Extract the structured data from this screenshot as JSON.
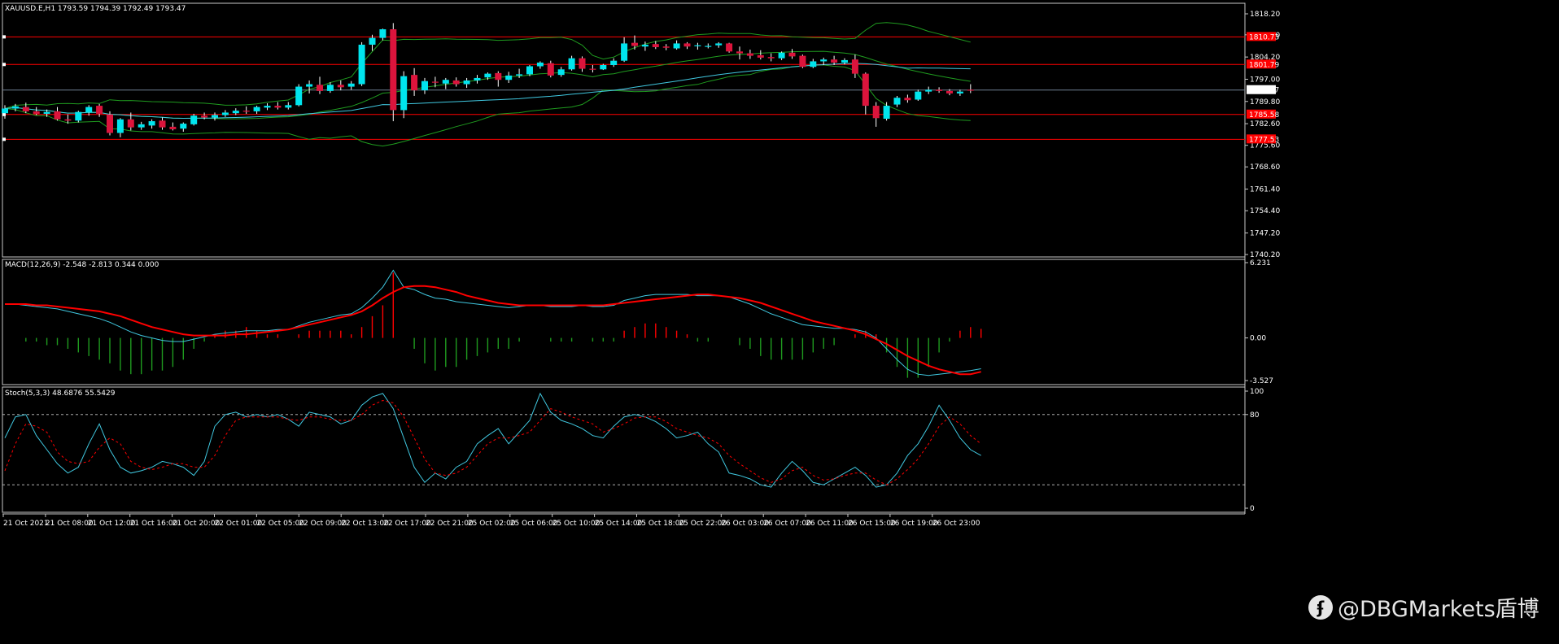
{
  "header": {
    "main": "XAUUSD.E,H1  1793.59 1794.39 1792.49 1793.47",
    "macd": "MACD(12,26,9) -2.548 -2.813 0.344 0.000",
    "stoch": "Stoch(5,3,3) 48.6876 55.5429"
  },
  "watermark": {
    "icon": "weibo-logo-icon",
    "text": "@DBGMarkets盾博"
  },
  "colors": {
    "bull": "#00e5ee",
    "bear": "#dc143c",
    "bollinger": "#1f9b1f",
    "ma": "#40c8e0",
    "level": "#ff0000",
    "signal": "#ff0000",
    "stoch_main": "#40c8e0",
    "stoch_signal": "#ff0000"
  },
  "chart_data": [
    {
      "type": "candlestick",
      "symbol": "XAUUSD.E",
      "timeframe": "H1",
      "ylim": [
        1740.2,
        1818.2
      ],
      "yticks": [
        "1818.20",
        "1811.40",
        "1804.20",
        "1797.00",
        "1789.80",
        "1782.60",
        "1775.60",
        "1768.60",
        "1761.40",
        "1754.40",
        "1747.20",
        "1740.20"
      ],
      "price_label": "1793.47",
      "levels": [
        1810.73,
        1801.79,
        1785.58,
        1777.53
      ],
      "level_labels": [
        "1810.73",
        "1801.79",
        "1785.58",
        "1777.53"
      ],
      "xticks": [
        "21 Oct 2021",
        "21 Oct 08:00",
        "21 Oct 12:00",
        "21 Oct 16:00",
        "21 Oct 20:00",
        "22 Oct 01:00",
        "22 Oct 05:00",
        "22 Oct 09:00",
        "22 Oct 13:00",
        "22 Oct 17:00",
        "22 Oct 21:00",
        "25 Oct 02:00",
        "25 Oct 06:00",
        "25 Oct 10:00",
        "25 Oct 14:00",
        "25 Oct 18:00",
        "25 Oct 22:00",
        "26 Oct 03:00",
        "26 Oct 07:00",
        "26 Oct 11:00",
        "26 Oct 15:00",
        "26 Oct 19:00",
        "26 Oct 23:00"
      ],
      "candles": [
        {
          "o": 1786.0,
          "h": 1788.6,
          "l": 1784.2,
          "c": 1787.5
        },
        {
          "o": 1787.5,
          "h": 1789.0,
          "l": 1786.6,
          "c": 1788.2
        },
        {
          "o": 1788.0,
          "h": 1789.4,
          "l": 1786.0,
          "c": 1786.6
        },
        {
          "o": 1786.6,
          "h": 1788.0,
          "l": 1785.4,
          "c": 1785.8
        },
        {
          "o": 1785.8,
          "h": 1787.2,
          "l": 1784.8,
          "c": 1786.4
        },
        {
          "o": 1786.6,
          "h": 1788.0,
          "l": 1783.6,
          "c": 1784.0
        },
        {
          "o": 1784.0,
          "h": 1785.6,
          "l": 1782.6,
          "c": 1783.6
        },
        {
          "o": 1783.6,
          "h": 1786.8,
          "l": 1783.0,
          "c": 1786.4
        },
        {
          "o": 1786.2,
          "h": 1788.6,
          "l": 1785.2,
          "c": 1788.0
        },
        {
          "o": 1788.4,
          "h": 1789.0,
          "l": 1784.8,
          "c": 1785.8
        },
        {
          "o": 1785.6,
          "h": 1786.6,
          "l": 1778.8,
          "c": 1779.6
        },
        {
          "o": 1779.6,
          "h": 1784.4,
          "l": 1778.2,
          "c": 1784.0
        },
        {
          "o": 1784.0,
          "h": 1786.2,
          "l": 1780.4,
          "c": 1781.4
        },
        {
          "o": 1781.4,
          "h": 1783.2,
          "l": 1780.6,
          "c": 1782.4
        },
        {
          "o": 1782.0,
          "h": 1784.0,
          "l": 1781.0,
          "c": 1783.4
        },
        {
          "o": 1783.6,
          "h": 1784.6,
          "l": 1780.6,
          "c": 1781.4
        },
        {
          "o": 1781.6,
          "h": 1783.0,
          "l": 1780.4,
          "c": 1780.8
        },
        {
          "o": 1781.0,
          "h": 1783.0,
          "l": 1780.0,
          "c": 1782.6
        },
        {
          "o": 1782.4,
          "h": 1785.8,
          "l": 1782.0,
          "c": 1785.2
        },
        {
          "o": 1785.2,
          "h": 1786.2,
          "l": 1784.0,
          "c": 1784.6
        },
        {
          "o": 1784.6,
          "h": 1786.2,
          "l": 1783.6,
          "c": 1785.4
        },
        {
          "o": 1785.4,
          "h": 1787.0,
          "l": 1784.8,
          "c": 1786.2
        },
        {
          "o": 1786.0,
          "h": 1787.6,
          "l": 1785.4,
          "c": 1786.8
        },
        {
          "o": 1786.8,
          "h": 1788.2,
          "l": 1785.8,
          "c": 1786.6
        },
        {
          "o": 1786.6,
          "h": 1788.4,
          "l": 1785.8,
          "c": 1788.0
        },
        {
          "o": 1787.8,
          "h": 1789.2,
          "l": 1787.0,
          "c": 1788.4
        },
        {
          "o": 1788.4,
          "h": 1789.6,
          "l": 1787.2,
          "c": 1787.8
        },
        {
          "o": 1787.8,
          "h": 1789.6,
          "l": 1787.2,
          "c": 1788.6
        },
        {
          "o": 1788.6,
          "h": 1795.4,
          "l": 1788.2,
          "c": 1794.6
        },
        {
          "o": 1794.6,
          "h": 1796.6,
          "l": 1792.4,
          "c": 1795.4
        },
        {
          "o": 1795.2,
          "h": 1797.8,
          "l": 1792.2,
          "c": 1793.2
        },
        {
          "o": 1793.2,
          "h": 1796.0,
          "l": 1792.6,
          "c": 1795.2
        },
        {
          "o": 1795.2,
          "h": 1796.6,
          "l": 1793.4,
          "c": 1794.4
        },
        {
          "o": 1794.6,
          "h": 1796.4,
          "l": 1793.6,
          "c": 1795.6
        },
        {
          "o": 1795.4,
          "h": 1809.0,
          "l": 1794.8,
          "c": 1808.2
        },
        {
          "o": 1808.2,
          "h": 1811.4,
          "l": 1806.2,
          "c": 1810.4
        },
        {
          "o": 1810.4,
          "h": 1813.4,
          "l": 1809.6,
          "c": 1813.2
        },
        {
          "o": 1813.2,
          "h": 1815.2,
          "l": 1783.4,
          "c": 1787.0
        },
        {
          "o": 1787.0,
          "h": 1799.6,
          "l": 1784.4,
          "c": 1798.0
        },
        {
          "o": 1798.4,
          "h": 1800.6,
          "l": 1791.6,
          "c": 1793.4
        },
        {
          "o": 1793.4,
          "h": 1797.4,
          "l": 1792.2,
          "c": 1796.4
        },
        {
          "o": 1796.2,
          "h": 1797.8,
          "l": 1794.4,
          "c": 1796.0
        },
        {
          "o": 1795.6,
          "h": 1797.4,
          "l": 1793.8,
          "c": 1796.8
        },
        {
          "o": 1796.6,
          "h": 1797.6,
          "l": 1794.6,
          "c": 1795.4
        },
        {
          "o": 1795.4,
          "h": 1797.4,
          "l": 1794.2,
          "c": 1796.6
        },
        {
          "o": 1796.6,
          "h": 1798.4,
          "l": 1795.6,
          "c": 1797.4
        },
        {
          "o": 1797.6,
          "h": 1799.2,
          "l": 1796.8,
          "c": 1798.8
        },
        {
          "o": 1799.0,
          "h": 1799.6,
          "l": 1794.6,
          "c": 1796.8
        },
        {
          "o": 1796.8,
          "h": 1799.4,
          "l": 1795.8,
          "c": 1798.2
        },
        {
          "o": 1798.2,
          "h": 1800.4,
          "l": 1797.4,
          "c": 1798.6
        },
        {
          "o": 1798.6,
          "h": 1801.6,
          "l": 1798.0,
          "c": 1801.2
        },
        {
          "o": 1801.2,
          "h": 1802.8,
          "l": 1800.4,
          "c": 1802.4
        },
        {
          "o": 1802.2,
          "h": 1803.0,
          "l": 1797.6,
          "c": 1798.2
        },
        {
          "o": 1798.4,
          "h": 1801.0,
          "l": 1797.8,
          "c": 1800.2
        },
        {
          "o": 1800.2,
          "h": 1804.6,
          "l": 1799.8,
          "c": 1803.8
        },
        {
          "o": 1803.8,
          "h": 1804.4,
          "l": 1799.4,
          "c": 1800.4
        },
        {
          "o": 1800.4,
          "h": 1801.6,
          "l": 1799.2,
          "c": 1800.2
        },
        {
          "o": 1800.2,
          "h": 1802.0,
          "l": 1800.0,
          "c": 1801.6
        },
        {
          "o": 1801.6,
          "h": 1803.8,
          "l": 1801.0,
          "c": 1803.0
        },
        {
          "o": 1803.0,
          "h": 1810.6,
          "l": 1802.6,
          "c": 1808.6
        },
        {
          "o": 1808.8,
          "h": 1811.2,
          "l": 1806.6,
          "c": 1807.8
        },
        {
          "o": 1807.6,
          "h": 1809.2,
          "l": 1806.2,
          "c": 1808.2
        },
        {
          "o": 1808.4,
          "h": 1809.4,
          "l": 1806.8,
          "c": 1807.4
        },
        {
          "o": 1807.6,
          "h": 1808.4,
          "l": 1806.4,
          "c": 1807.2
        },
        {
          "o": 1807.0,
          "h": 1809.6,
          "l": 1806.6,
          "c": 1808.6
        },
        {
          "o": 1808.6,
          "h": 1809.0,
          "l": 1806.8,
          "c": 1807.6
        },
        {
          "o": 1807.8,
          "h": 1808.8,
          "l": 1806.6,
          "c": 1808.0
        },
        {
          "o": 1807.8,
          "h": 1808.6,
          "l": 1807.0,
          "c": 1807.8
        },
        {
          "o": 1808.0,
          "h": 1809.0,
          "l": 1807.2,
          "c": 1808.6
        },
        {
          "o": 1808.6,
          "h": 1808.8,
          "l": 1805.6,
          "c": 1806.0
        },
        {
          "o": 1806.0,
          "h": 1807.6,
          "l": 1803.4,
          "c": 1805.4
        },
        {
          "o": 1805.4,
          "h": 1806.6,
          "l": 1803.6,
          "c": 1804.6
        },
        {
          "o": 1804.8,
          "h": 1806.4,
          "l": 1803.4,
          "c": 1804.0
        },
        {
          "o": 1804.2,
          "h": 1805.4,
          "l": 1802.8,
          "c": 1803.8
        },
        {
          "o": 1803.8,
          "h": 1806.0,
          "l": 1803.2,
          "c": 1805.6
        },
        {
          "o": 1805.6,
          "h": 1806.8,
          "l": 1803.6,
          "c": 1804.4
        },
        {
          "o": 1804.6,
          "h": 1805.0,
          "l": 1800.6,
          "c": 1801.0
        },
        {
          "o": 1801.0,
          "h": 1803.6,
          "l": 1800.6,
          "c": 1802.8
        },
        {
          "o": 1802.8,
          "h": 1804.0,
          "l": 1801.6,
          "c": 1803.4
        },
        {
          "o": 1803.4,
          "h": 1804.6,
          "l": 1801.6,
          "c": 1802.4
        },
        {
          "o": 1802.4,
          "h": 1803.8,
          "l": 1801.8,
          "c": 1803.2
        },
        {
          "o": 1803.4,
          "h": 1805.0,
          "l": 1797.4,
          "c": 1798.8
        },
        {
          "o": 1798.8,
          "h": 1799.2,
          "l": 1785.6,
          "c": 1788.4
        },
        {
          "o": 1788.4,
          "h": 1789.6,
          "l": 1781.6,
          "c": 1784.4
        },
        {
          "o": 1784.2,
          "h": 1789.6,
          "l": 1783.6,
          "c": 1788.4
        },
        {
          "o": 1788.8,
          "h": 1791.6,
          "l": 1788.0,
          "c": 1791.0
        },
        {
          "o": 1791.0,
          "h": 1792.0,
          "l": 1789.4,
          "c": 1790.2
        },
        {
          "o": 1790.4,
          "h": 1793.6,
          "l": 1790.0,
          "c": 1793.0
        },
        {
          "o": 1793.0,
          "h": 1794.6,
          "l": 1792.2,
          "c": 1793.6
        },
        {
          "o": 1793.6,
          "h": 1794.4,
          "l": 1792.6,
          "c": 1793.2
        },
        {
          "o": 1793.2,
          "h": 1793.8,
          "l": 1791.8,
          "c": 1792.4
        },
        {
          "o": 1792.4,
          "h": 1793.6,
          "l": 1791.6,
          "c": 1793.0
        },
        {
          "o": 1793.6,
          "h": 1795.4,
          "l": 1792.5,
          "c": 1793.5
        }
      ]
    },
    {
      "type": "line",
      "name": "MACD(12,26,9)",
      "ylim": [
        -3.527,
        6.231
      ],
      "yticks": [
        "6.231",
        "0.00",
        "-3.527"
      ],
      "macd": [
        2.8,
        2.8,
        2.7,
        2.6,
        2.5,
        2.4,
        2.2,
        2.0,
        1.8,
        1.6,
        1.3,
        0.9,
        0.5,
        0.2,
        0.0,
        -0.2,
        -0.3,
        -0.3,
        -0.1,
        0.1,
        0.3,
        0.4,
        0.5,
        0.6,
        0.6,
        0.6,
        0.7,
        0.7,
        1.0,
        1.3,
        1.5,
        1.7,
        1.9,
        2.0,
        2.5,
        3.3,
        4.2,
        5.6,
        4.2,
        4.0,
        3.6,
        3.3,
        3.2,
        3.0,
        2.9,
        2.8,
        2.7,
        2.6,
        2.5,
        2.6,
        2.7,
        2.7,
        2.6,
        2.6,
        2.6,
        2.7,
        2.6,
        2.6,
        2.7,
        3.1,
        3.3,
        3.5,
        3.6,
        3.6,
        3.6,
        3.6,
        3.5,
        3.5,
        3.5,
        3.4,
        3.1,
        2.8,
        2.4,
        2.0,
        1.7,
        1.4,
        1.1,
        1.0,
        0.9,
        0.8,
        0.8,
        0.7,
        0.5,
        0.0,
        -0.9,
        -1.8,
        -2.6,
        -3.0,
        -3.1,
        -3.0,
        -2.9,
        -2.8,
        -2.7,
        -2.55
      ],
      "signal": [
        2.8,
        2.8,
        2.8,
        2.7,
        2.7,
        2.6,
        2.5,
        2.4,
        2.3,
        2.2,
        2.0,
        1.8,
        1.5,
        1.2,
        0.9,
        0.7,
        0.5,
        0.3,
        0.2,
        0.2,
        0.2,
        0.2,
        0.3,
        0.3,
        0.4,
        0.5,
        0.6,
        0.7,
        0.9,
        1.1,
        1.3,
        1.5,
        1.7,
        1.9,
        2.2,
        2.7,
        3.3,
        3.8,
        4.2,
        4.3,
        4.3,
        4.2,
        4.0,
        3.8,
        3.5,
        3.3,
        3.1,
        2.9,
        2.8,
        2.7,
        2.7,
        2.7,
        2.7,
        2.7,
        2.7,
        2.7,
        2.7,
        2.7,
        2.8,
        2.9,
        3.0,
        3.1,
        3.2,
        3.3,
        3.4,
        3.5,
        3.6,
        3.6,
        3.5,
        3.4,
        3.3,
        3.1,
        2.9,
        2.6,
        2.3,
        2.0,
        1.7,
        1.4,
        1.2,
        1.0,
        0.8,
        0.6,
        0.3,
        -0.1,
        -0.5,
        -1.0,
        -1.5,
        -1.9,
        -2.3,
        -2.6,
        -2.8,
        -3.0,
        -3.0,
        -2.8
      ]
    },
    {
      "type": "line",
      "name": "Stoch(5,3,3)",
      "ylim": [
        0,
        100
      ],
      "yticks": [
        "100",
        "80",
        "0"
      ],
      "levels": [
        80,
        20
      ],
      "main": [
        60,
        78,
        80,
        62,
        50,
        38,
        30,
        35,
        55,
        72,
        50,
        35,
        30,
        32,
        35,
        40,
        38,
        35,
        28,
        40,
        70,
        80,
        82,
        78,
        80,
        78,
        80,
        76,
        70,
        82,
        80,
        78,
        72,
        75,
        88,
        95,
        98,
        85,
        60,
        35,
        22,
        30,
        25,
        35,
        40,
        55,
        62,
        68,
        55,
        65,
        75,
        98,
        82,
        75,
        72,
        68,
        62,
        60,
        70,
        78,
        80,
        78,
        74,
        68,
        60,
        62,
        65,
        55,
        48,
        30,
        28,
        25,
        20,
        18,
        30,
        40,
        32,
        22,
        20,
        25,
        30,
        35,
        28,
        18,
        20,
        30,
        45,
        55,
        70,
        88,
        75,
        60,
        50,
        45
      ],
      "signal": [
        32,
        55,
        72,
        70,
        65,
        48,
        40,
        38,
        40,
        52,
        60,
        55,
        40,
        35,
        33,
        35,
        38,
        38,
        35,
        35,
        45,
        62,
        75,
        78,
        78,
        78,
        78,
        76,
        75,
        78,
        78,
        76,
        75,
        75,
        80,
        88,
        92,
        90,
        78,
        60,
        42,
        30,
        28,
        30,
        35,
        45,
        55,
        60,
        60,
        62,
        65,
        75,
        85,
        82,
        78,
        75,
        72,
        65,
        68,
        72,
        77,
        78,
        78,
        74,
        68,
        65,
        62,
        60,
        55,
        45,
        38,
        32,
        26,
        22,
        25,
        32,
        35,
        28,
        24,
        25,
        28,
        30,
        30,
        24,
        20,
        25,
        33,
        42,
        55,
        70,
        78,
        72,
        62,
        55
      ]
    }
  ]
}
